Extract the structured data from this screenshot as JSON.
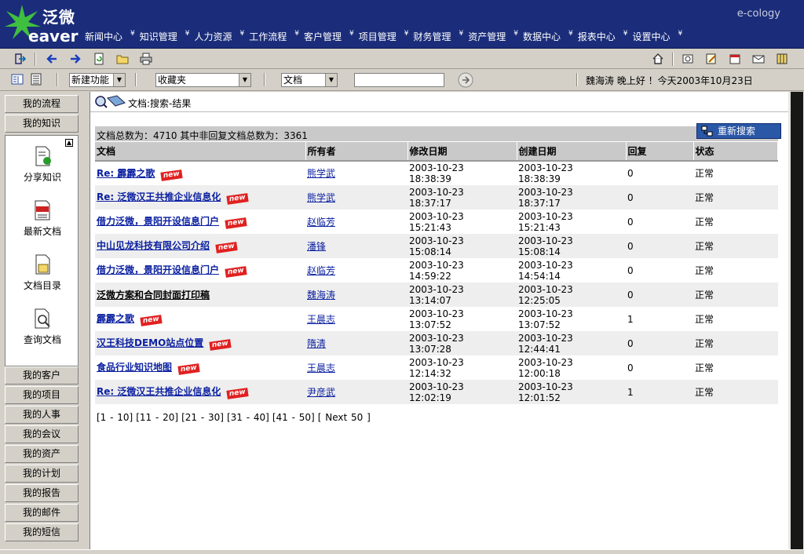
{
  "header": {
    "logo_cn": "泛微",
    "logo_en": "eaver",
    "brand": "e-cology",
    "nav": [
      "新闻中心",
      "知识管理",
      "人力资源",
      "工作流程",
      "客户管理",
      "项目管理",
      "财务管理",
      "资产管理",
      "数据中心",
      "报表中心",
      "设置中心"
    ]
  },
  "toolbar2": {
    "new_func": "新建功能",
    "favorites": "收藏夹",
    "doc_type": "文档",
    "search_value": "",
    "greeting": "魏海涛 晚上好 ！今天2003年10月23日"
  },
  "sidebar": {
    "top": [
      "我的流程",
      "我的知识"
    ],
    "tools": [
      {
        "label": "分享知识",
        "icon": "share-knowledge-icon"
      },
      {
        "label": "最新文档",
        "icon": "new-document-icon"
      },
      {
        "label": "文档目录",
        "icon": "document-directory-icon"
      },
      {
        "label": "查询文档",
        "icon": "search-document-icon"
      }
    ],
    "bottom": [
      "我的客户",
      "我的项目",
      "我的人事",
      "我的会议",
      "我的资产",
      "我的计划",
      "我的报告",
      "我的邮件",
      "我的短信"
    ]
  },
  "main": {
    "crumb": "文档:搜索-结果",
    "summary": "文档总数为：4710 其中非回复文档总数为：3361",
    "research_label": "重新搜索",
    "columns": [
      "文档",
      "所有者",
      "修改日期",
      "创建日期",
      "回复",
      "状态"
    ],
    "new_badge": "new",
    "rows": [
      {
        "title": "Re: 霹霹之歌",
        "new": true,
        "owner": "熊学武",
        "mod_date": "2003-10-23",
        "mod_time": "18:38:39",
        "cre_date": "2003-10-23",
        "cre_time": "18:38:39",
        "replies": "0",
        "status": "正常"
      },
      {
        "title": "Re: 泛微汉王共推企业信息化",
        "new": true,
        "owner": "熊学武",
        "mod_date": "2003-10-23",
        "mod_time": "18:37:17",
        "cre_date": "2003-10-23",
        "cre_time": "18:37:17",
        "replies": "0",
        "status": "正常"
      },
      {
        "title": "借力泛微，景阳开设信息门户",
        "new": true,
        "owner": "赵临芳",
        "mod_date": "2003-10-23",
        "mod_time": "15:21:43",
        "cre_date": "2003-10-23",
        "cre_time": "15:21:43",
        "replies": "0",
        "status": "正常"
      },
      {
        "title": "中山见龙科技有限公司介绍",
        "new": true,
        "owner": "潘锋",
        "mod_date": "2003-10-23",
        "mod_time": "15:08:14",
        "cre_date": "2003-10-23",
        "cre_time": "15:08:14",
        "replies": "0",
        "status": "正常"
      },
      {
        "title": "借力泛微，景阳开设信息门户",
        "new": true,
        "owner": "赵临芳",
        "mod_date": "2003-10-23",
        "mod_time": "14:59:22",
        "cre_date": "2003-10-23",
        "cre_time": "14:54:14",
        "replies": "0",
        "status": "正常"
      },
      {
        "title": "泛微方案和合同封面打印稿",
        "new": false,
        "owner": "魏海涛",
        "mod_date": "2003-10-23",
        "mod_time": "13:14:07",
        "cre_date": "2003-10-23",
        "cre_time": "12:25:05",
        "replies": "0",
        "status": "正常"
      },
      {
        "title": "霹霹之歌",
        "new": true,
        "owner": "王晨志",
        "mod_date": "2003-10-23",
        "mod_time": "13:07:52",
        "cre_date": "2003-10-23",
        "cre_time": "13:07:52",
        "replies": "1",
        "status": "正常"
      },
      {
        "title": "汉王科技DEMO站点位置",
        "new": true,
        "owner": "隋清",
        "mod_date": "2003-10-23",
        "mod_time": "13:07:28",
        "cre_date": "2003-10-23",
        "cre_time": "12:44:41",
        "replies": "0",
        "status": "正常"
      },
      {
        "title": "食品行业知识地图",
        "new": true,
        "owner": "王晨志",
        "mod_date": "2003-10-23",
        "mod_time": "12:14:32",
        "cre_date": "2003-10-23",
        "cre_time": "12:00:18",
        "replies": "0",
        "status": "正常"
      },
      {
        "title": "Re: 泛微汉王共推企业信息化",
        "new": true,
        "owner": "尹彦武",
        "mod_date": "2003-10-23",
        "mod_time": "12:02:19",
        "cre_date": "2003-10-23",
        "cre_time": "12:01:52",
        "replies": "1",
        "status": "正常"
      }
    ],
    "pager": [
      "[1 - 10]",
      "[11 - 20]",
      "[21 - 30]",
      "[31 - 40]",
      "[41 - 50]",
      "[ Next 50 ]"
    ]
  },
  "colors": {
    "header_bg": "#1b2d7a",
    "link": "#0a1fa0",
    "new_badge": "#e02020",
    "button_blue": "#2a57a6"
  }
}
